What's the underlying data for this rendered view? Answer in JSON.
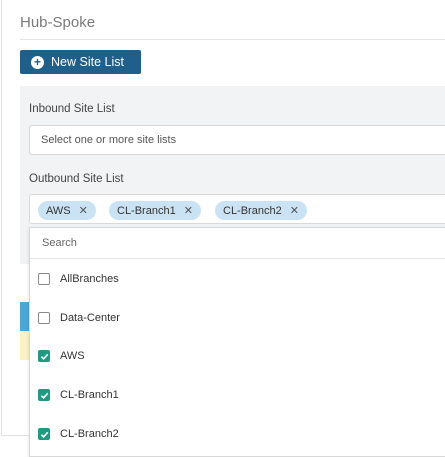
{
  "panel": {
    "title": "Hub-Spoke"
  },
  "toolbar": {
    "new_site_list_label": "New Site List"
  },
  "inbound": {
    "label": "Inbound Site List",
    "placeholder": "Select one or more site lists"
  },
  "outbound": {
    "label": "Outbound Site List",
    "chips": [
      {
        "label": "AWS"
      },
      {
        "label": "CL-Branch1"
      },
      {
        "label": "CL-Branch2"
      }
    ],
    "search_placeholder": "Search",
    "options": [
      {
        "label": "AllBranches",
        "checked": false
      },
      {
        "label": "Data-Center",
        "checked": false
      },
      {
        "label": "AWS",
        "checked": true
      },
      {
        "label": "CL-Branch1",
        "checked": true
      },
      {
        "label": "CL-Branch2",
        "checked": true
      }
    ]
  },
  "colors": {
    "primary_button": "#1f5f8b",
    "chip_background": "#c9e3f4",
    "checkbox_checked": "#1f9b82"
  }
}
